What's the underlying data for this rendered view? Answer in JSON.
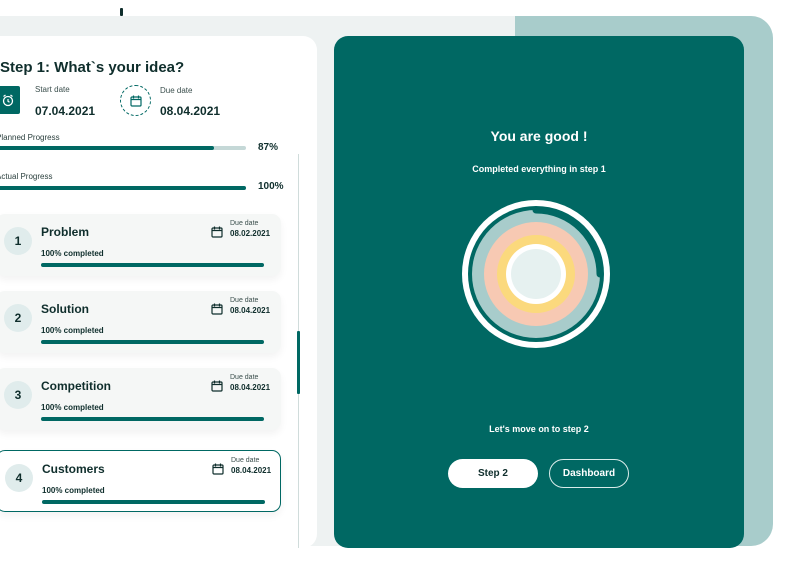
{
  "step_header": {
    "title": "Step 1: What`s your idea?",
    "start_label": "Start date",
    "start_value": "07.04.2021",
    "due_label": "Due date",
    "due_value": "08.04.2021"
  },
  "progress": {
    "planned": {
      "label": "Planned  Progress",
      "percent_text": "87%",
      "value": 0.87
    },
    "actual": {
      "label": "Actual Progress",
      "percent_text": "100%",
      "value": 1.0
    }
  },
  "steps": [
    {
      "num": "1",
      "name": "Problem",
      "due_label": "Due date",
      "due_value": "08.02.2021",
      "completed": "100% completed"
    },
    {
      "num": "2",
      "name": "Solution",
      "due_label": "Due date",
      "due_value": "08.04.2021",
      "completed": "100% completed"
    },
    {
      "num": "3",
      "name": "Competition",
      "due_label": "Due date",
      "due_value": "08.04.2021",
      "completed": "100% completed"
    },
    {
      "num": "4",
      "name": "Customers",
      "due_label": "Due date",
      "due_value": "08.04.2021",
      "completed": "100% completed",
      "active": true
    }
  ],
  "summary": {
    "title": "You are good !",
    "subtitle": "Completed everything in step 1",
    "move_text": "Let's move on to step 2",
    "step2_button": "Step 2",
    "dashboard_button": "Dashboard"
  },
  "colors": {
    "accent": "#006863",
    "ring_outer": "#a8cccb",
    "ring_middle": "#f7c9b3",
    "ring_inner": "#fbd97d",
    "ring_core": "#e6f1f0"
  },
  "icons": {
    "start": "alarm-clock-icon",
    "due": "calendar-icon",
    "step_due": "calendar-icon"
  }
}
